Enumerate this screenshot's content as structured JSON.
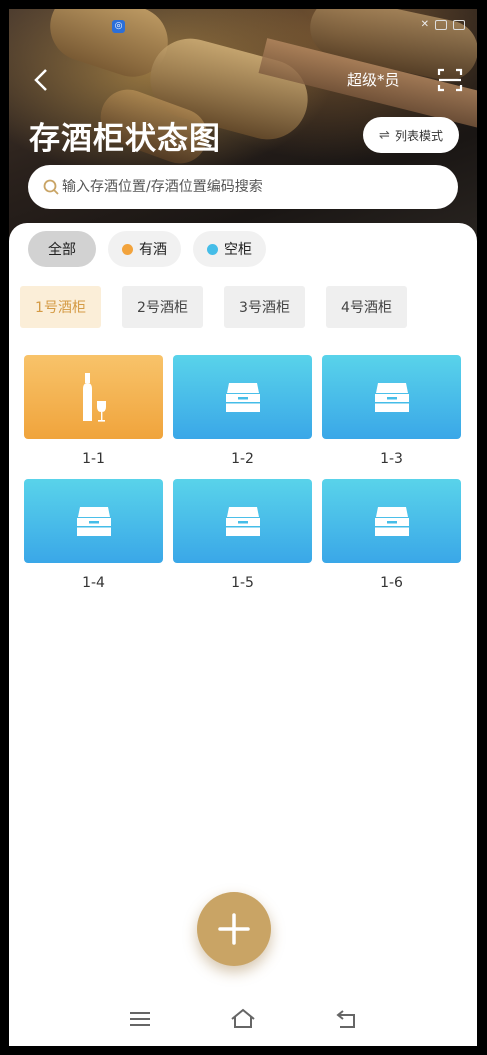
{
  "status_bar": {
    "app_badge": "◎",
    "right_text": "✕"
  },
  "header": {
    "back_icon": "chevron-left-icon",
    "role": "超级*员",
    "scan_icon": "scan-icon",
    "title": "存酒柜状态图",
    "list_mode_label": "列表模式",
    "list_mode_icon": "⇌"
  },
  "search": {
    "placeholder": "输入存酒位置/存酒位置编码搜索"
  },
  "filters": [
    {
      "label": "全部",
      "active": true
    },
    {
      "label": "有酒",
      "color": "#f2a33c"
    },
    {
      "label": "空柜",
      "color": "#45bde8"
    }
  ],
  "cabinet_tabs": [
    {
      "label": "1号酒柜",
      "active": true
    },
    {
      "label": "2号酒柜"
    },
    {
      "label": "3号酒柜"
    },
    {
      "label": "4号酒柜"
    }
  ],
  "slots": [
    {
      "label": "1-1",
      "state": "full"
    },
    {
      "label": "1-2",
      "state": "empty"
    },
    {
      "label": "1-3",
      "state": "empty"
    },
    {
      "label": "1-4",
      "state": "empty"
    },
    {
      "label": "1-5",
      "state": "empty"
    },
    {
      "label": "1-6",
      "state": "empty"
    }
  ],
  "colors": {
    "accent": "#c9a465",
    "full": "#f0a43c",
    "empty": "#3aa7e8",
    "tab_active_text": "#d49a44"
  },
  "fab": {
    "icon": "plus-icon"
  },
  "nav": {
    "menu_icon": "menu-icon",
    "home_icon": "home-icon",
    "back_icon": "back-icon"
  }
}
